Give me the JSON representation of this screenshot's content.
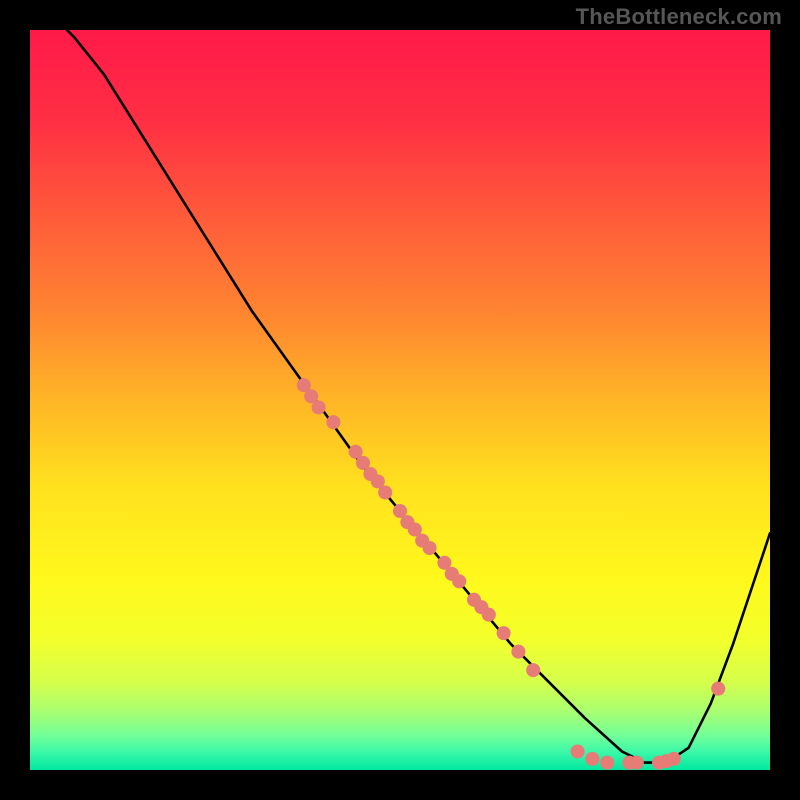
{
  "watermark": "TheBottleneck.com",
  "chart_data": {
    "type": "line",
    "title": "",
    "xlabel": "",
    "ylabel": "",
    "xlim": [
      0,
      100
    ],
    "ylim": [
      0,
      100
    ],
    "curve": {
      "x": [
        0,
        3,
        6,
        10,
        15,
        20,
        25,
        30,
        35,
        40,
        45,
        50,
        55,
        60,
        65,
        70,
        75,
        80,
        83,
        86,
        89,
        92,
        95,
        98,
        100
      ],
      "y": [
        104,
        102,
        99,
        94,
        86,
        78,
        70,
        62,
        55,
        48,
        41,
        35,
        29,
        23,
        17,
        12,
        7,
        2.5,
        1,
        1,
        3,
        9,
        17,
        26,
        32
      ]
    },
    "markers": {
      "pink": [
        {
          "x": 37,
          "y": 52
        },
        {
          "x": 38,
          "y": 50.5
        },
        {
          "x": 39,
          "y": 49
        },
        {
          "x": 41,
          "y": 47
        },
        {
          "x": 44,
          "y": 43
        },
        {
          "x": 45,
          "y": 41.5
        },
        {
          "x": 46,
          "y": 40
        },
        {
          "x": 47,
          "y": 39
        },
        {
          "x": 48,
          "y": 37.5
        },
        {
          "x": 50,
          "y": 35
        },
        {
          "x": 51,
          "y": 33.5
        },
        {
          "x": 52,
          "y": 32.5
        },
        {
          "x": 53,
          "y": 31
        },
        {
          "x": 54,
          "y": 30
        },
        {
          "x": 56,
          "y": 28
        },
        {
          "x": 57,
          "y": 26.5
        },
        {
          "x": 58,
          "y": 25.5
        },
        {
          "x": 60,
          "y": 23
        },
        {
          "x": 61,
          "y": 22
        },
        {
          "x": 62,
          "y": 21
        },
        {
          "x": 64,
          "y": 18.5
        },
        {
          "x": 66,
          "y": 16
        },
        {
          "x": 68,
          "y": 13.5
        },
        {
          "x": 74,
          "y": 2.5
        },
        {
          "x": 76,
          "y": 1.5
        },
        {
          "x": 78,
          "y": 1
        },
        {
          "x": 81,
          "y": 1
        },
        {
          "x": 82,
          "y": 1
        },
        {
          "x": 85,
          "y": 1
        },
        {
          "x": 86,
          "y": 1.2
        },
        {
          "x": 87,
          "y": 1.5
        },
        {
          "x": 93,
          "y": 11
        }
      ]
    },
    "gradient_stops": [
      {
        "offset": 0.0,
        "color": "#ff1a48"
      },
      {
        "offset": 0.12,
        "color": "#ff2e44"
      },
      {
        "offset": 0.25,
        "color": "#ff5a3a"
      },
      {
        "offset": 0.38,
        "color": "#ff8431"
      },
      {
        "offset": 0.5,
        "color": "#ffb526"
      },
      {
        "offset": 0.62,
        "color": "#ffe21e"
      },
      {
        "offset": 0.74,
        "color": "#fff81c"
      },
      {
        "offset": 0.82,
        "color": "#f4ff2a"
      },
      {
        "offset": 0.88,
        "color": "#d6ff4a"
      },
      {
        "offset": 0.92,
        "color": "#aaff70"
      },
      {
        "offset": 0.955,
        "color": "#6fff9a"
      },
      {
        "offset": 0.978,
        "color": "#35f7a8"
      },
      {
        "offset": 1.0,
        "color": "#00e8a0"
      }
    ],
    "marker_color": "#e77b75",
    "curve_color": "#000000"
  }
}
